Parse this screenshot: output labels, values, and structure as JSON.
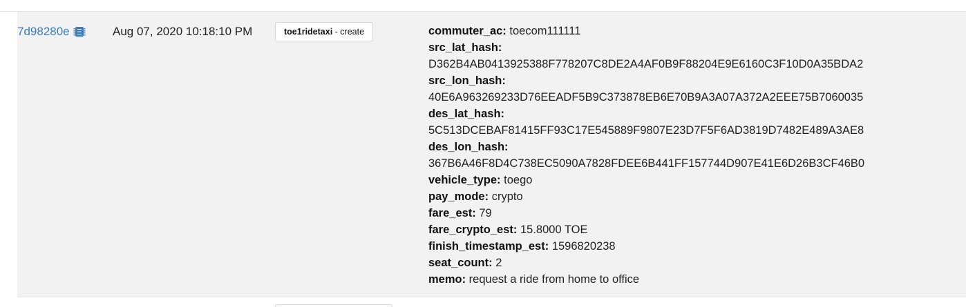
{
  "header_cut_text": "",
  "row": {
    "tx_id": "7d98280e",
    "tx_icon": "cpu-chip-icon",
    "timestamp": "Aug 07, 2020 10:18:10 PM",
    "action": {
      "contract": "toe1ridetaxi",
      "separator": " - ",
      "name": "create"
    },
    "details": [
      {
        "key": "commuter_ac:",
        "value": " toecom111111",
        "block": false
      },
      {
        "key": "src_lat_hash:",
        "value": "D362B4AB0413925388F778207C8DE2A4AF0B9F88204E9E6160C3F10D0A35BDA2",
        "block": true
      },
      {
        "key": "src_lon_hash:",
        "value": "40E6A963269233D76EEADF5B9C373878EB6E70B9A3A07A372A2EEE75B7060035",
        "block": true
      },
      {
        "key": "des_lat_hash:",
        "value": "5C513DCEBAF81415FF93C17E545889F9807E23D7F5F6AD3819D7482E489A3AE8",
        "block": true
      },
      {
        "key": "des_lon_hash:",
        "value": "367B6A46F8D4C738EC5090A7828FDEE6B441FF157744D907E41E6D26B3CF46B0",
        "block": true
      },
      {
        "key": "vehicle_type:",
        "value": " toego",
        "block": false
      },
      {
        "key": "pay_mode:",
        "value": " crypto",
        "block": false
      },
      {
        "key": "fare_est:",
        "value": " 79",
        "block": false
      },
      {
        "key": "fare_crypto_est:",
        "value": " 15.8000 TOE",
        "block": false
      },
      {
        "key": "finish_timestamp_est:",
        "value": " 1596820238",
        "block": false
      },
      {
        "key": "seat_count:",
        "value": " 2",
        "block": false
      },
      {
        "key": "memo:",
        "value": " request a ride from home to office",
        "block": false
      }
    ]
  },
  "colors": {
    "link": "#3c7bbf",
    "row_bg": "#f2f2f2"
  }
}
